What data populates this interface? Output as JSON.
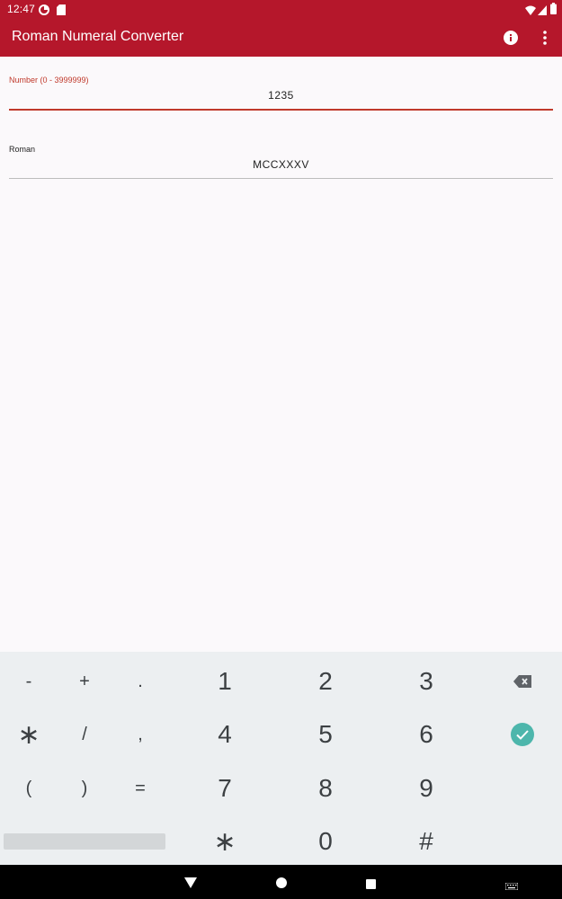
{
  "status_bar": {
    "time": "12:47",
    "icons": [
      "data-saver-icon",
      "sd-card-icon",
      "wifi-icon",
      "signal-icon",
      "battery-icon"
    ]
  },
  "app_bar": {
    "title": "Roman Numeral Converter",
    "icons": [
      "info-icon",
      "more-vert-icon"
    ],
    "background": "#b5172b"
  },
  "fields": {
    "number": {
      "label": "Number (0 - 3999999)",
      "value": "1235",
      "accent": "#c0392b"
    },
    "roman": {
      "label": "Roman",
      "value": "MCCXXXV"
    }
  },
  "keyboard": {
    "rows": [
      [
        "-",
        "+",
        ".",
        "1",
        "2",
        "3",
        "backspace"
      ],
      [
        "∗",
        "/",
        ",",
        "4",
        "5",
        "6",
        "done"
      ],
      [
        "(",
        ")",
        "=",
        "7",
        "8",
        "9"
      ],
      [
        "space",
        "∗",
        "0",
        "#"
      ]
    ],
    "done_color": "#4db6ac",
    "icons": [
      "backspace-icon",
      "check-circle-icon"
    ]
  },
  "nav_bar": {
    "icons": [
      "back-icon",
      "home-icon",
      "recents-icon",
      "keyboard-switch-icon"
    ]
  }
}
